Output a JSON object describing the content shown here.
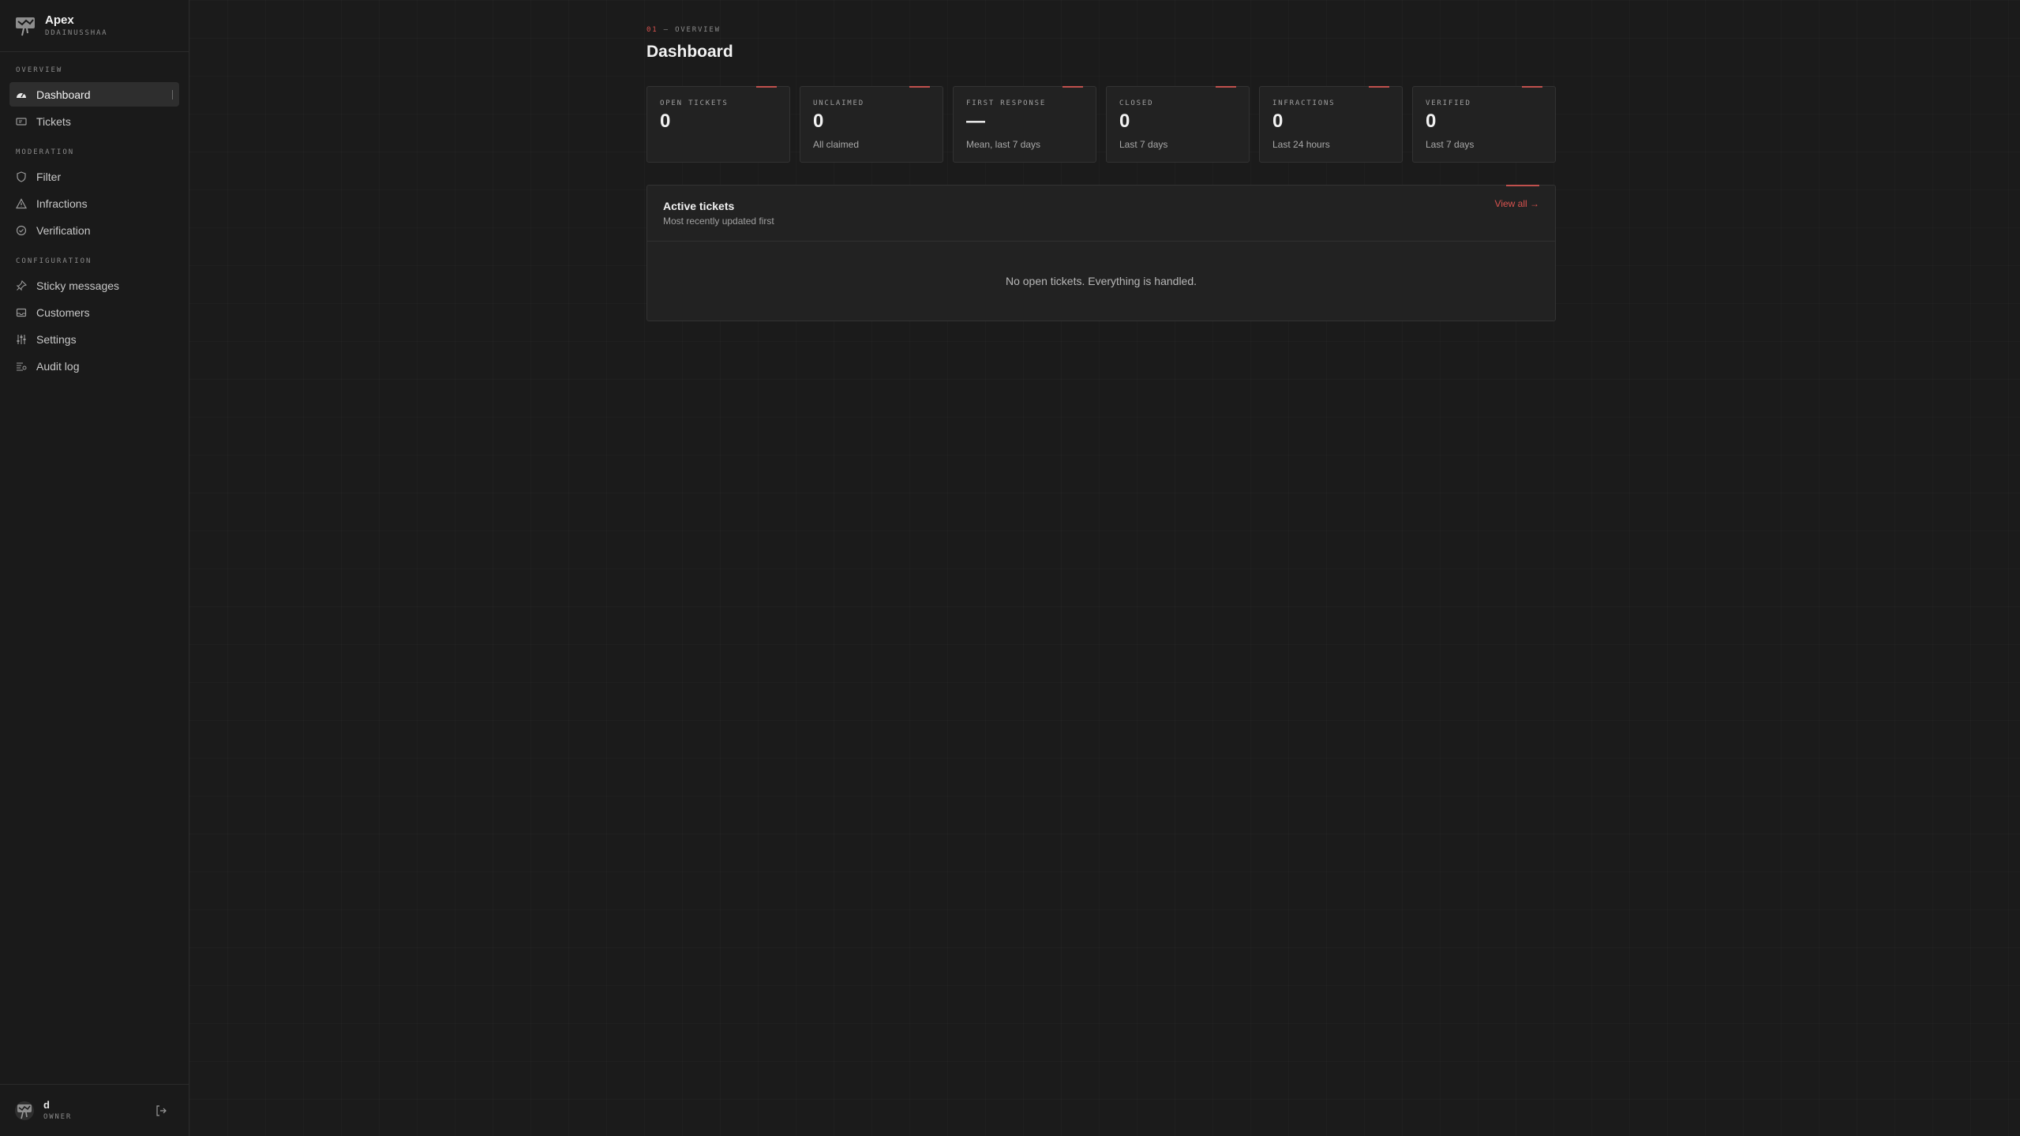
{
  "brand": {
    "name": "Apex",
    "sub": "DDAINUSSHAA"
  },
  "sidebar": {
    "sections": [
      {
        "label": "OVERVIEW",
        "items": [
          {
            "label": "Dashboard",
            "icon": "gauge-icon",
            "active": true
          },
          {
            "label": "Tickets",
            "icon": "ticket-icon"
          }
        ]
      },
      {
        "label": "MODERATION",
        "items": [
          {
            "label": "Filter",
            "icon": "shield-icon"
          },
          {
            "label": "Infractions",
            "icon": "warning-icon"
          },
          {
            "label": "Verification",
            "icon": "check-circle-icon"
          }
        ]
      },
      {
        "label": "CONFIGURATION",
        "items": [
          {
            "label": "Sticky messages",
            "icon": "pin-icon"
          },
          {
            "label": "Customers",
            "icon": "inbox-icon"
          },
          {
            "label": "Settings",
            "icon": "sliders-icon"
          },
          {
            "label": "Audit log",
            "icon": "list-icon"
          }
        ]
      }
    ]
  },
  "user": {
    "name": "d",
    "role": "OWNER",
    "logout_icon": "logout-icon"
  },
  "header": {
    "eyebrow_num": "01",
    "eyebrow_text": "— OVERVIEW",
    "title": "Dashboard"
  },
  "stats": [
    {
      "label": "OPEN TICKETS",
      "value": "0",
      "sub": ""
    },
    {
      "label": "UNCLAIMED",
      "value": "0",
      "sub": "All claimed"
    },
    {
      "label": "FIRST RESPONSE",
      "value": "—",
      "sub": "Mean, last 7 days"
    },
    {
      "label": "CLOSED",
      "value": "0",
      "sub": "Last 7 days"
    },
    {
      "label": "INFRACTIONS",
      "value": "0",
      "sub": "Last 24 hours"
    },
    {
      "label": "VERIFIED",
      "value": "0",
      "sub": "Last 7 days"
    }
  ],
  "panel": {
    "title": "Active tickets",
    "sub": "Most recently updated first",
    "link": "View all →",
    "empty": "No open tickets. Everything is handled."
  },
  "colors": {
    "accent": "#d9534f",
    "background": "#1b1b1b",
    "card": "#222222"
  }
}
